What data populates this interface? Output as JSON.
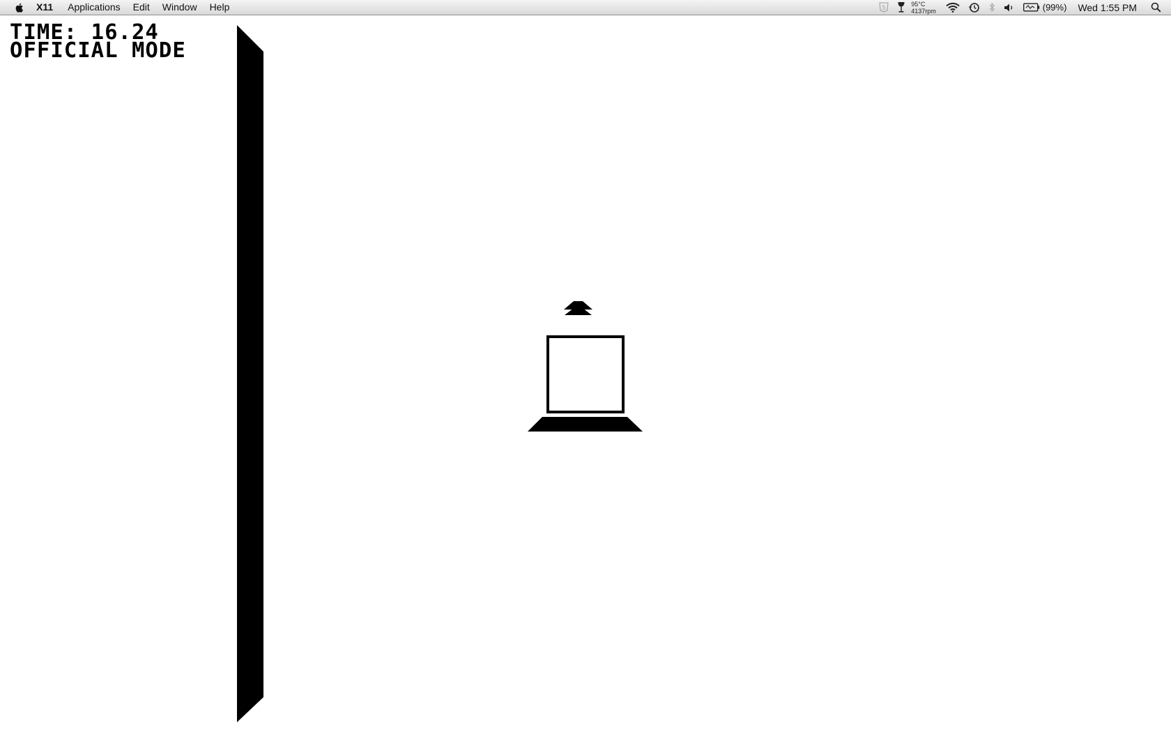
{
  "menubar": {
    "apple_icon": "apple-icon",
    "app_name": "X11",
    "menus": [
      "Applications",
      "Edit",
      "Window",
      "Help"
    ],
    "status": {
      "temperature": "95°C",
      "fan_speed": "4137rpm",
      "battery_percent": "(99%)",
      "clock": "Wed 1:55 PM",
      "icons": [
        "html5-shield-icon",
        "wine-glass-icon",
        "wifi-icon",
        "time-machine-icon",
        "bluetooth-icon",
        "volume-icon",
        "battery-icon",
        "spotlight-icon"
      ]
    }
  },
  "game": {
    "hud": {
      "time_line": "TIME: 16.24",
      "mode_line": "OFFICIAL MODE"
    },
    "colors": {
      "background": "#ffffff",
      "foreground": "#000000"
    }
  }
}
